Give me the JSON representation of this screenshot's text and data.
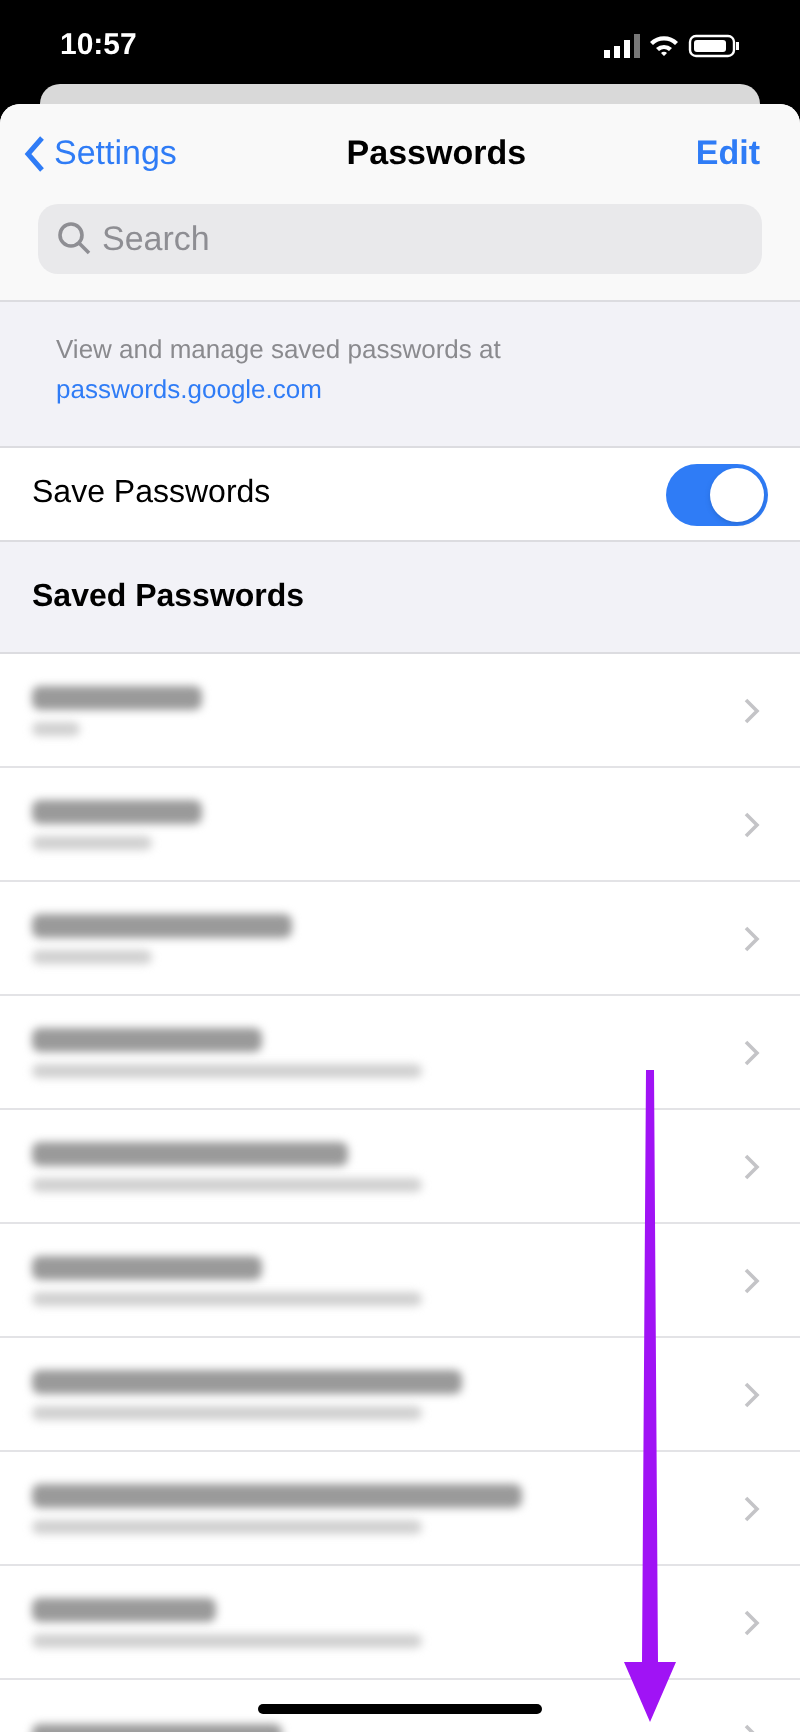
{
  "status_bar": {
    "time": "10:57"
  },
  "nav": {
    "back": "Settings",
    "title": "Passwords",
    "action": "Edit"
  },
  "search": {
    "placeholder": "Search"
  },
  "info": {
    "text": "View and manage saved passwords at",
    "link": "passwords.google.com"
  },
  "save_passwords": {
    "label": "Save Passwords",
    "on": true
  },
  "section_header": "Saved Passwords",
  "rows": [
    {
      "kind": "blurred"
    },
    {
      "kind": "blurred"
    },
    {
      "kind": "blurred"
    },
    {
      "kind": "blurred"
    },
    {
      "kind": "blurred"
    },
    {
      "kind": "blurred"
    },
    {
      "kind": "blurred"
    },
    {
      "kind": "blurred"
    },
    {
      "kind": "blurred"
    },
    {
      "kind": "blurred_cut"
    }
  ]
}
